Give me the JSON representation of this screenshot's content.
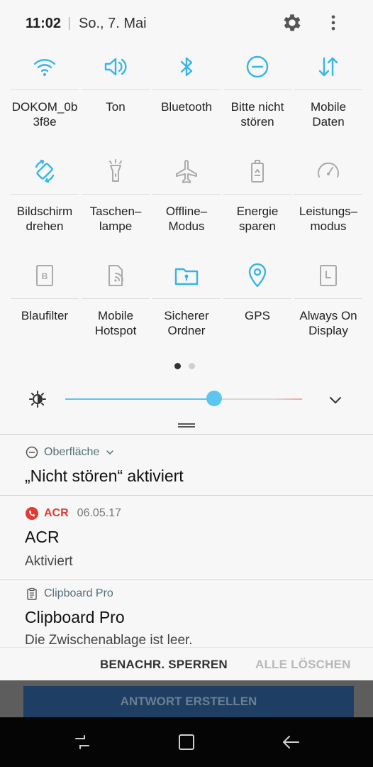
{
  "status": {
    "time": "11:02",
    "date": "So., 7. Mai"
  },
  "tiles": [
    {
      "label": "DOKOM_0b\n3f8e",
      "icon": "wifi-icon",
      "active": true
    },
    {
      "label": "Ton",
      "icon": "volume-icon",
      "active": true
    },
    {
      "label": "Bluetooth",
      "icon": "bluetooth-icon",
      "active": true
    },
    {
      "label": "Bitte nicht\nstören",
      "icon": "do-not-disturb-icon",
      "active": true
    },
    {
      "label": "Mobile\nDaten",
      "icon": "mobile-data-icon",
      "active": true
    },
    {
      "label": "Bildschirm\ndrehen",
      "icon": "auto-rotate-icon",
      "active": true
    },
    {
      "label": "Taschen–\nlampe",
      "icon": "flashlight-icon",
      "active": false
    },
    {
      "label": "Offline–\nModus",
      "icon": "airplane-icon",
      "active": false
    },
    {
      "label": "Energie\nsparen",
      "icon": "battery-saver-icon",
      "active": false
    },
    {
      "label": "Leistungs–\nmodus",
      "icon": "performance-icon",
      "active": false
    },
    {
      "label": "Blaufilter",
      "icon": "blue-light-filter-icon",
      "active": false
    },
    {
      "label": "Mobile\nHotspot",
      "icon": "hotspot-icon",
      "active": false
    },
    {
      "label": "Sicherer\nOrdner",
      "icon": "secure-folder-icon",
      "active": true
    },
    {
      "label": "GPS",
      "icon": "location-icon",
      "active": true
    },
    {
      "label": "Always On\nDisplay",
      "icon": "always-on-display-icon",
      "active": false
    }
  ],
  "pager": {
    "current_page": 1,
    "page_count": 2
  },
  "brightness": {
    "level": 0.63
  },
  "notifications": {
    "dnd": {
      "app": "Oberfläche",
      "title": "„Nicht stören“ aktiviert"
    },
    "acr": {
      "app": "ACR",
      "date": "06.05.17",
      "title": "ACR",
      "body": "Aktiviert"
    },
    "clipboard": {
      "app": "Clipboard Pro",
      "title": "Clipboard Pro",
      "body": "Die Zwischenablage ist leer."
    }
  },
  "actions": {
    "block": "BENACHR. SPERREN",
    "clear": "ALLE LÖSCHEN"
  },
  "background_app": {
    "reply_button": "ANTWORT ERSTELLEN"
  },
  "colors": {
    "accent": "#37b4e8",
    "inactive": "#aaaaaa",
    "acr_red": "#e23b32"
  }
}
